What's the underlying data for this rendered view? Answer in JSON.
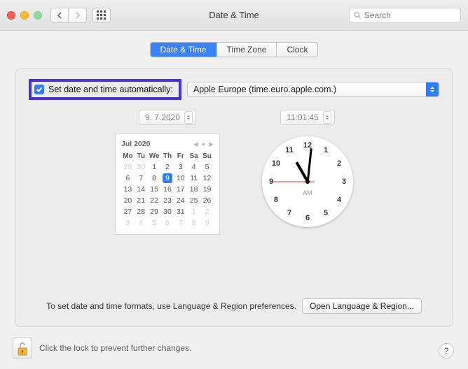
{
  "window": {
    "title": "Date & Time",
    "search_placeholder": "Search"
  },
  "tabs": {
    "date_time": "Date & Time",
    "time_zone": "Time Zone",
    "clock": "Clock"
  },
  "auto": {
    "label": "Set date and time automatically:",
    "server": "Apple Europe (time.euro.apple.com.)",
    "checked": true
  },
  "date_field": "9.  7.2020",
  "time_field": "11:01:45",
  "calendar": {
    "month_year": "Jul 2020",
    "weekdays": [
      "Mo",
      "Tu",
      "We",
      "Th",
      "Fr",
      "Sa",
      "Su"
    ],
    "rows": [
      [
        {
          "n": 29,
          "m": true
        },
        {
          "n": 30,
          "m": true
        },
        {
          "n": 1
        },
        {
          "n": 2
        },
        {
          "n": 3
        },
        {
          "n": 4
        },
        {
          "n": 5
        }
      ],
      [
        {
          "n": 6
        },
        {
          "n": 7
        },
        {
          "n": 8
        },
        {
          "n": 9,
          "sel": true
        },
        {
          "n": 10
        },
        {
          "n": 11
        },
        {
          "n": 12
        }
      ],
      [
        {
          "n": 13
        },
        {
          "n": 14
        },
        {
          "n": 15
        },
        {
          "n": 16
        },
        {
          "n": 17
        },
        {
          "n": 18
        },
        {
          "n": 19
        }
      ],
      [
        {
          "n": 20
        },
        {
          "n": 21
        },
        {
          "n": 22
        },
        {
          "n": 23
        },
        {
          "n": 24
        },
        {
          "n": 25
        },
        {
          "n": 26
        }
      ],
      [
        {
          "n": 27
        },
        {
          "n": 28
        },
        {
          "n": 29
        },
        {
          "n": 30
        },
        {
          "n": 31
        },
        {
          "n": 1,
          "m": true
        },
        {
          "n": 2,
          "m": true
        }
      ],
      [
        {
          "n": 3,
          "m": true
        },
        {
          "n": 4,
          "m": true
        },
        {
          "n": 5,
          "m": true
        },
        {
          "n": 6,
          "m": true
        },
        {
          "n": 7,
          "m": true
        },
        {
          "n": 8,
          "m": true
        },
        {
          "n": 9,
          "m": true
        }
      ]
    ]
  },
  "clock": {
    "numbers": [
      "12",
      "1",
      "2",
      "3",
      "4",
      "5",
      "6",
      "7",
      "8",
      "9",
      "10",
      "11"
    ],
    "ampm": "AM"
  },
  "footer": {
    "hint": "To set date and time formats, use Language & Region preferences.",
    "button": "Open Language & Region..."
  },
  "lock": {
    "text": "Click the lock to prevent further changes."
  },
  "help": "?"
}
